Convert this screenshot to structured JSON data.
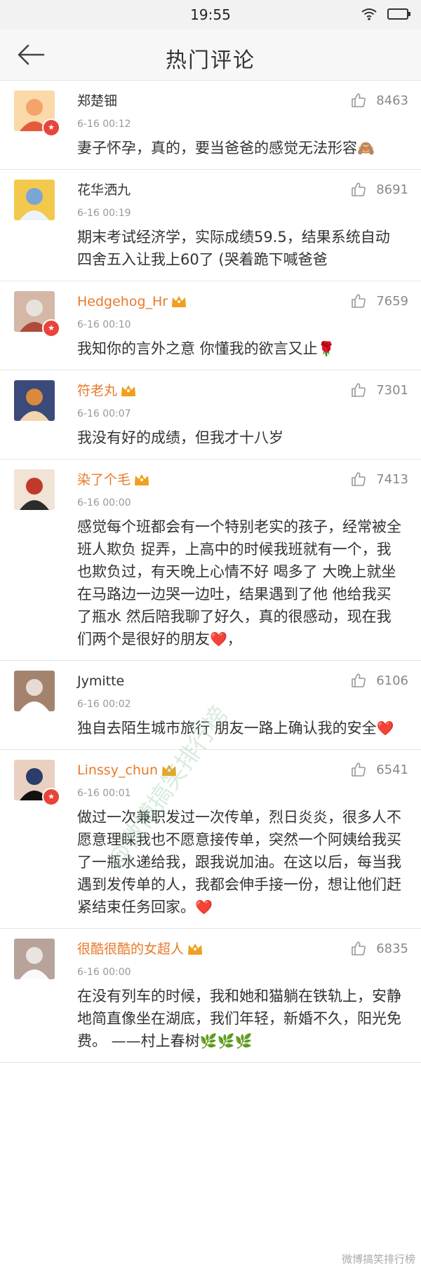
{
  "status_bar": {
    "time": "19:55"
  },
  "header": {
    "title": "热门评论"
  },
  "comments": [
    {
      "name": "郑楚钿",
      "time": "6-16 00:12",
      "likes": "8463",
      "text": "妻子怀孕，真的，要当爸爸的感觉无法形容",
      "emoji": "🙈",
      "vip": false,
      "verified": true
    },
    {
      "name": "花华洒九",
      "time": "6-16 00:19",
      "likes": "8691",
      "text": "期末考试经济学，实际成绩59.5，结果系统自动四舍五入让我上60了 (哭着跪下喊爸爸",
      "emoji": "",
      "vip": false,
      "verified": false
    },
    {
      "name": "Hedgehog_Hr",
      "time": "6-16 00:10",
      "likes": "7659",
      "text": "我知你的言外之意  你懂我的欲言又止",
      "emoji": "🌹",
      "vip": true,
      "verified": true
    },
    {
      "name": "符老丸",
      "time": "6-16 00:07",
      "likes": "7301",
      "text": "我没有好的成绩，但我才十八岁",
      "emoji": "",
      "vip": true,
      "verified": false
    },
    {
      "name": "染了个毛",
      "time": "6-16 00:00",
      "likes": "7413",
      "text": "感觉每个班都会有一个特别老实的孩子，经常被全班人欺负 捉弄，上高中的时候我班就有一个，我也欺负过，有天晚上心情不好 喝多了 大晚上就坐在马路边一边哭一边吐，结果遇到了他 他给我买了瓶水 然后陪我聊了好久，真的很感动，现在我们两个是很好的朋友",
      "emoji": "❤️，",
      "vip": true,
      "verified": false
    },
    {
      "name": "Jymitte",
      "time": "6-16 00:02",
      "likes": "6106",
      "text": "独自去陌生城市旅行 朋友一路上确认我的安全",
      "emoji": "❤️",
      "vip": false,
      "verified": false
    },
    {
      "name": "Linssy_chun",
      "time": "6-16 00:01",
      "likes": "6541",
      "text": "做过一次兼职发过一次传单，烈日炎炎，很多人不愿意理睬我也不愿意接传单，突然一个阿姨给我买了一瓶水递给我，跟我说加油。在这以后，每当我遇到发传单的人，我都会伸手接一份，想让他们赶紧结束任务回家。",
      "emoji": "❤️",
      "vip": true,
      "verified": true
    },
    {
      "name": "很酷很酷的女超人",
      "time": "6-16 00:00",
      "likes": "6835",
      "text": "在没有列车的时候，我和她和猫躺在铁轨上，安静地简直像坐在湖底，我们年轻，新婚不久，阳光免费。  ——村上春树",
      "emoji": "🌿🌿🌿",
      "vip": true,
      "verified": false
    }
  ],
  "watermark": {
    "diagonal": "@微博搞笑排行榜",
    "corner": "微博搞笑排行榜"
  },
  "colors": {
    "vip_name": "#e87a2a",
    "badge": "#e8443a",
    "crown": "#f0a020"
  }
}
